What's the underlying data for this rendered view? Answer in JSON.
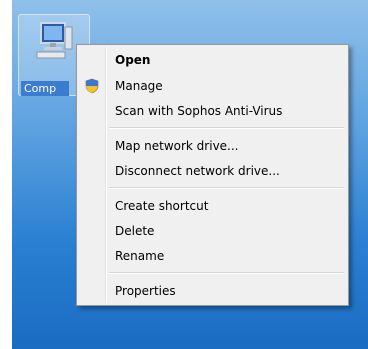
{
  "desktop": {
    "icon_label": "Comp",
    "icon_name": "computer-icon"
  },
  "context_menu": {
    "items": [
      {
        "label": "Open",
        "bold": true
      },
      {
        "label": "Manage",
        "icon": "uac-shield-icon"
      },
      {
        "label": "Scan with Sophos Anti-Virus"
      },
      {
        "label": "Map network drive..."
      },
      {
        "label": "Disconnect network drive..."
      },
      {
        "label": "Create shortcut"
      },
      {
        "label": "Delete"
      },
      {
        "label": "Rename"
      },
      {
        "label": "Properties"
      }
    ]
  },
  "colors": {
    "desktop_top": "#8fc0ea",
    "desktop_bottom": "#1a6cc2",
    "menu_background": "#f0f0f0",
    "menu_border": "#979797"
  }
}
